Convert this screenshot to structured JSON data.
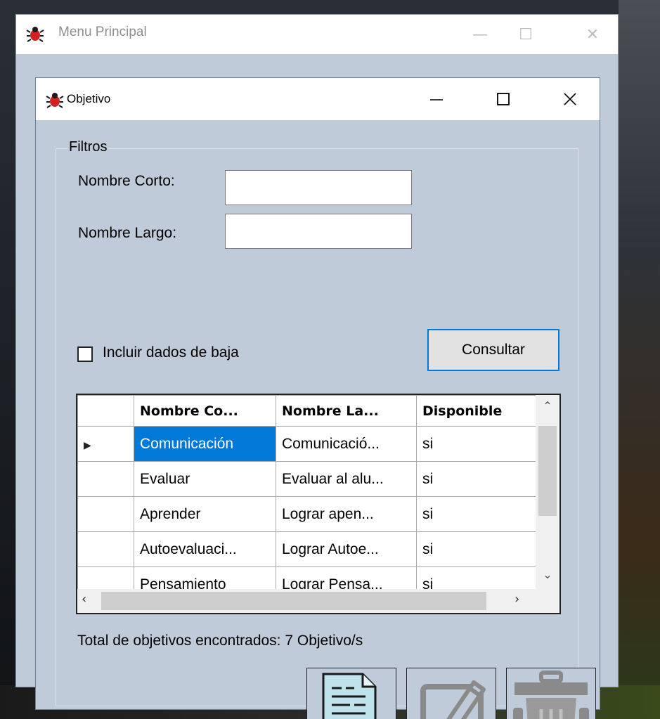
{
  "main_window": {
    "title": "Menu Principal",
    "minimize_label": "—",
    "maximize_label": "☐",
    "close_label": "✕"
  },
  "child_window": {
    "title": "Objetivo",
    "minimize_label": "—",
    "maximize_label": "☐",
    "close_label": "✕"
  },
  "filters": {
    "group_label": "Filtros",
    "short_name_label": "Nombre Corto:",
    "short_name_value": "",
    "long_name_label": "Nombre Largo:",
    "long_name_value": "",
    "include_inactive_label": "Incluir dados de baja",
    "include_inactive_checked": false,
    "consult_button": "Consultar"
  },
  "grid": {
    "columns": [
      "Nombre Co...",
      "Nombre La...",
      "Disponible"
    ],
    "rows": [
      {
        "short": "Comunicación",
        "long": "Comunicació...",
        "available": "si",
        "selected": true
      },
      {
        "short": "Evaluar",
        "long": "Evaluar al alu...",
        "available": "si",
        "selected": false
      },
      {
        "short": "Aprender",
        "long": "Lograr apen...",
        "available": "si",
        "selected": false
      },
      {
        "short": "Autoevaluaci...",
        "long": "Lograr Autoe...",
        "available": "si",
        "selected": false
      },
      {
        "short": "Pensamiento",
        "long": "Lograr Pensa...",
        "available": "si",
        "selected": false
      }
    ]
  },
  "footer": {
    "total_text": "Total de objetivos encontrados: 7 Objetivo/s"
  },
  "actions": {
    "new_icon": "new-document-icon",
    "edit_icon": "edit-icon",
    "delete_icon": "trash-icon"
  },
  "colors": {
    "selection": "#0078d7",
    "window_bg": "#bfcbd8",
    "app_icon": "#d32020"
  }
}
